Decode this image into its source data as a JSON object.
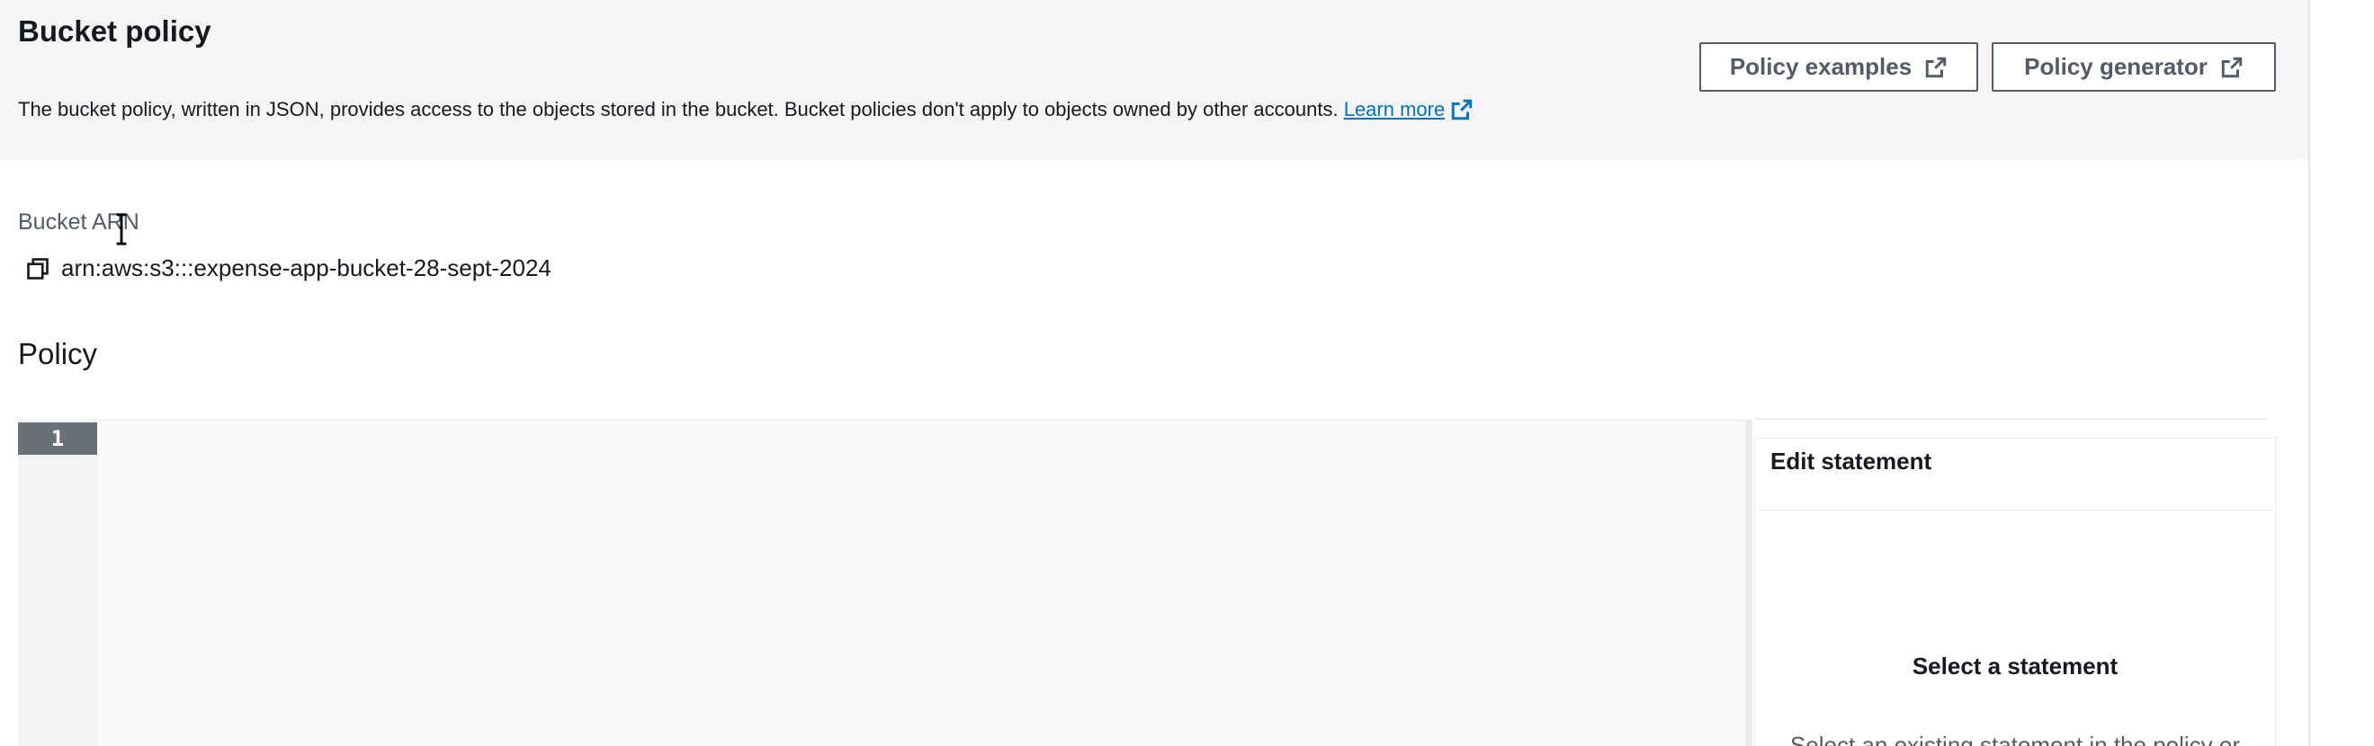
{
  "header": {
    "title": "Bucket policy",
    "description": "The bucket policy, written in JSON, provides access to the objects stored in the bucket. Bucket policies don't apply to objects owned by other accounts.",
    "learn_more": "Learn more",
    "buttons": {
      "policy_examples": "Policy examples",
      "policy_generator": "Policy generator"
    }
  },
  "arn": {
    "label": "Bucket ARN",
    "value": "arn:aws:s3:::expense-app-bucket-28-sept-2024"
  },
  "policy": {
    "label": "Policy",
    "editor": {
      "active_line_number": "1",
      "content": ""
    },
    "statement_panel": {
      "title": "Edit statement",
      "empty_title": "Select a statement",
      "empty_description": "Select an existing statement in the policy or"
    }
  },
  "colors": {
    "link": "#0073bb",
    "header_band": "#f5f5f5",
    "gutter_active": "#687078",
    "button_border": "#545b64"
  },
  "icons": {
    "external_link": "external-link-icon",
    "copy": "copy-icon",
    "cursor": "text-cursor-icon"
  }
}
